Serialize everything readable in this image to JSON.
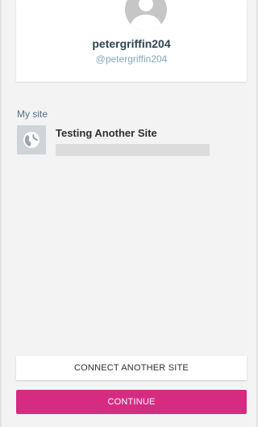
{
  "profile": {
    "username": "petergriffin204",
    "handle": "@petergriffin204",
    "avatar_icon": "default-avatar-icon"
  },
  "sites_section": {
    "label": "My site",
    "sites": [
      {
        "name": "Testing Another Site",
        "icon": "globe-icon"
      }
    ]
  },
  "actions": {
    "connect_label": "CONNECT ANOTHER SITE",
    "continue_label": "CONTINUE"
  },
  "colors": {
    "accent": "#d52c82",
    "label_blue": "#4f748e",
    "handle_blue": "#87a6bc",
    "background": "#f3f3f3"
  }
}
